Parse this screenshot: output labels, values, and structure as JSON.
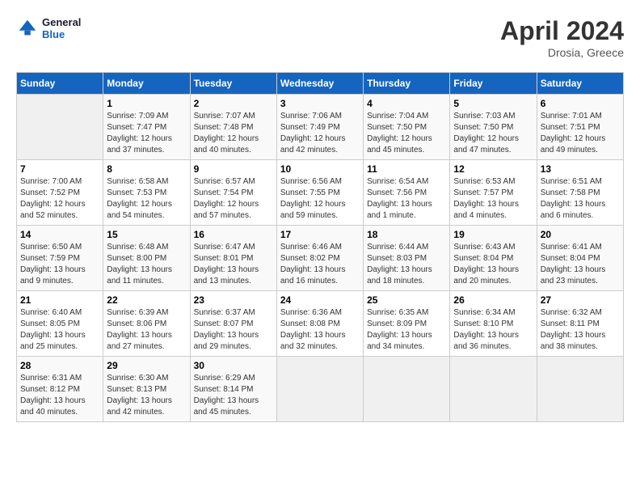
{
  "header": {
    "logo_line1": "General",
    "logo_line2": "Blue",
    "month_year": "April 2024",
    "location": "Drosia, Greece"
  },
  "days_of_week": [
    "Sunday",
    "Monday",
    "Tuesday",
    "Wednesday",
    "Thursday",
    "Friday",
    "Saturday"
  ],
  "weeks": [
    [
      {
        "num": "",
        "info": ""
      },
      {
        "num": "1",
        "info": "Sunrise: 7:09 AM\nSunset: 7:47 PM\nDaylight: 12 hours\nand 37 minutes."
      },
      {
        "num": "2",
        "info": "Sunrise: 7:07 AM\nSunset: 7:48 PM\nDaylight: 12 hours\nand 40 minutes."
      },
      {
        "num": "3",
        "info": "Sunrise: 7:06 AM\nSunset: 7:49 PM\nDaylight: 12 hours\nand 42 minutes."
      },
      {
        "num": "4",
        "info": "Sunrise: 7:04 AM\nSunset: 7:50 PM\nDaylight: 12 hours\nand 45 minutes."
      },
      {
        "num": "5",
        "info": "Sunrise: 7:03 AM\nSunset: 7:50 PM\nDaylight: 12 hours\nand 47 minutes."
      },
      {
        "num": "6",
        "info": "Sunrise: 7:01 AM\nSunset: 7:51 PM\nDaylight: 12 hours\nand 49 minutes."
      }
    ],
    [
      {
        "num": "7",
        "info": "Sunrise: 7:00 AM\nSunset: 7:52 PM\nDaylight: 12 hours\nand 52 minutes."
      },
      {
        "num": "8",
        "info": "Sunrise: 6:58 AM\nSunset: 7:53 PM\nDaylight: 12 hours\nand 54 minutes."
      },
      {
        "num": "9",
        "info": "Sunrise: 6:57 AM\nSunset: 7:54 PM\nDaylight: 12 hours\nand 57 minutes."
      },
      {
        "num": "10",
        "info": "Sunrise: 6:56 AM\nSunset: 7:55 PM\nDaylight: 12 hours\nand 59 minutes."
      },
      {
        "num": "11",
        "info": "Sunrise: 6:54 AM\nSunset: 7:56 PM\nDaylight: 13 hours\nand 1 minute."
      },
      {
        "num": "12",
        "info": "Sunrise: 6:53 AM\nSunset: 7:57 PM\nDaylight: 13 hours\nand 4 minutes."
      },
      {
        "num": "13",
        "info": "Sunrise: 6:51 AM\nSunset: 7:58 PM\nDaylight: 13 hours\nand 6 minutes."
      }
    ],
    [
      {
        "num": "14",
        "info": "Sunrise: 6:50 AM\nSunset: 7:59 PM\nDaylight: 13 hours\nand 9 minutes."
      },
      {
        "num": "15",
        "info": "Sunrise: 6:48 AM\nSunset: 8:00 PM\nDaylight: 13 hours\nand 11 minutes."
      },
      {
        "num": "16",
        "info": "Sunrise: 6:47 AM\nSunset: 8:01 PM\nDaylight: 13 hours\nand 13 minutes."
      },
      {
        "num": "17",
        "info": "Sunrise: 6:46 AM\nSunset: 8:02 PM\nDaylight: 13 hours\nand 16 minutes."
      },
      {
        "num": "18",
        "info": "Sunrise: 6:44 AM\nSunset: 8:03 PM\nDaylight: 13 hours\nand 18 minutes."
      },
      {
        "num": "19",
        "info": "Sunrise: 6:43 AM\nSunset: 8:04 PM\nDaylight: 13 hours\nand 20 minutes."
      },
      {
        "num": "20",
        "info": "Sunrise: 6:41 AM\nSunset: 8:04 PM\nDaylight: 13 hours\nand 23 minutes."
      }
    ],
    [
      {
        "num": "21",
        "info": "Sunrise: 6:40 AM\nSunset: 8:05 PM\nDaylight: 13 hours\nand 25 minutes."
      },
      {
        "num": "22",
        "info": "Sunrise: 6:39 AM\nSunset: 8:06 PM\nDaylight: 13 hours\nand 27 minutes."
      },
      {
        "num": "23",
        "info": "Sunrise: 6:37 AM\nSunset: 8:07 PM\nDaylight: 13 hours\nand 29 minutes."
      },
      {
        "num": "24",
        "info": "Sunrise: 6:36 AM\nSunset: 8:08 PM\nDaylight: 13 hours\nand 32 minutes."
      },
      {
        "num": "25",
        "info": "Sunrise: 6:35 AM\nSunset: 8:09 PM\nDaylight: 13 hours\nand 34 minutes."
      },
      {
        "num": "26",
        "info": "Sunrise: 6:34 AM\nSunset: 8:10 PM\nDaylight: 13 hours\nand 36 minutes."
      },
      {
        "num": "27",
        "info": "Sunrise: 6:32 AM\nSunset: 8:11 PM\nDaylight: 13 hours\nand 38 minutes."
      }
    ],
    [
      {
        "num": "28",
        "info": "Sunrise: 6:31 AM\nSunset: 8:12 PM\nDaylight: 13 hours\nand 40 minutes."
      },
      {
        "num": "29",
        "info": "Sunrise: 6:30 AM\nSunset: 8:13 PM\nDaylight: 13 hours\nand 42 minutes."
      },
      {
        "num": "30",
        "info": "Sunrise: 6:29 AM\nSunset: 8:14 PM\nDaylight: 13 hours\nand 45 minutes."
      },
      {
        "num": "",
        "info": ""
      },
      {
        "num": "",
        "info": ""
      },
      {
        "num": "",
        "info": ""
      },
      {
        "num": "",
        "info": ""
      }
    ]
  ]
}
